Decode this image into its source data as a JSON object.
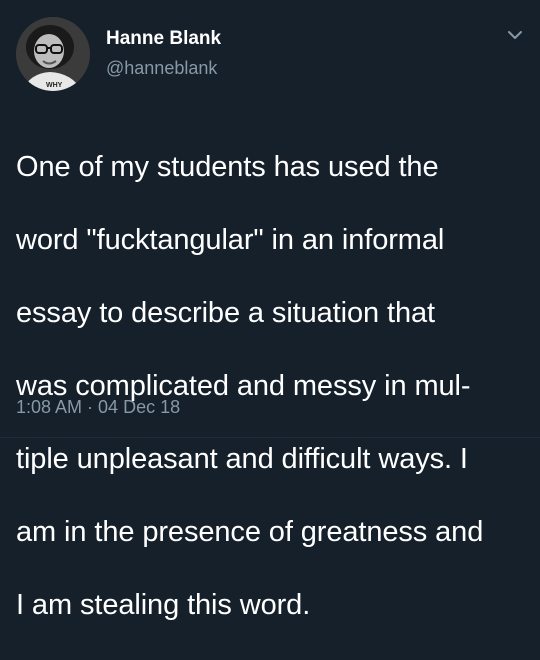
{
  "tweet": {
    "author_name": "Hanne Blank",
    "author_handle": "@hanneblank",
    "avatar_shirt_text": "WHY",
    "text_lines": [
      "One of my students has used the",
      "word \"fucktangular\" in an informal",
      "essay to describe a situation that",
      "was complicated and messy in mul-",
      "tiple unpleasant and difficult ways.  I",
      "am in the presence of greatness and",
      "I am stealing this word."
    ],
    "time": "1:08 AM",
    "separator": "·",
    "date": "04 Dec 18"
  },
  "colors": {
    "background": "#15202b",
    "primary_text": "#ffffff",
    "secondary_text": "#8899a6"
  },
  "icons": {
    "menu": "chevron-down-icon"
  }
}
